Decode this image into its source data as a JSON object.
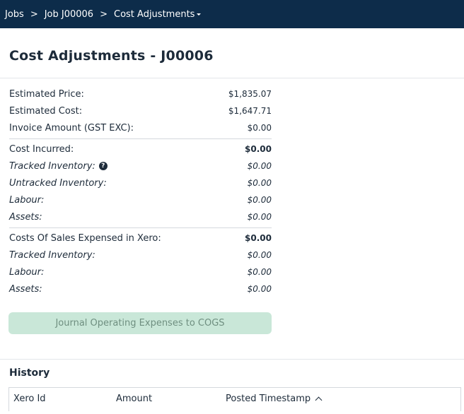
{
  "breadcrumb": {
    "items": [
      "Jobs",
      "Job J00006",
      "Cost Adjustments"
    ],
    "separator": ">"
  },
  "page": {
    "title": "Cost Adjustments - J00006"
  },
  "summary": {
    "estimated_price": {
      "label": "Estimated Price:",
      "value": "$1,835.07"
    },
    "estimated_cost": {
      "label": "Estimated Cost:",
      "value": "$1,647.71"
    },
    "invoice_amount": {
      "label": "Invoice Amount (GST EXC):",
      "value": "$0.00"
    },
    "cost_incurred": {
      "label": "Cost Incurred:",
      "value": "$0.00",
      "tracked_inventory": {
        "label": "Tracked Inventory:",
        "value": "$0.00"
      },
      "untracked_inventory": {
        "label": "Untracked Inventory:",
        "value": "$0.00"
      },
      "labour": {
        "label": "Labour:",
        "value": "$0.00"
      },
      "assets": {
        "label": "Assets:",
        "value": "$0.00"
      }
    },
    "costs_of_sales": {
      "label": "Costs Of Sales Expensed in Xero:",
      "value": "$0.00",
      "tracked_inventory": {
        "label": "Tracked Inventory:",
        "value": "$0.00"
      },
      "labour": {
        "label": "Labour:",
        "value": "$0.00"
      },
      "assets": {
        "label": "Assets:",
        "value": "$0.00"
      }
    }
  },
  "actions": {
    "journal_button": "Journal Operating Expenses to COGS"
  },
  "history": {
    "title": "History",
    "columns": [
      "Xero Id",
      "Amount",
      "Posted Timestamp"
    ]
  },
  "colors": {
    "topbar": "#0d2c4a",
    "button_disabled_bg": "#c9e7d8"
  }
}
